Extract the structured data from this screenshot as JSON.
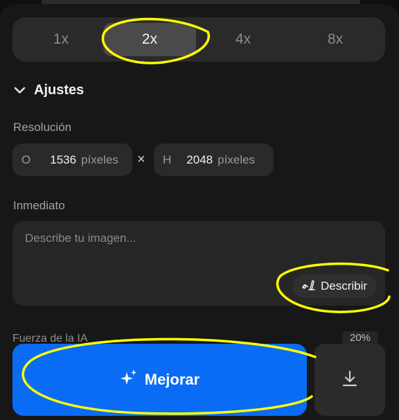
{
  "scale": {
    "options": [
      "1x",
      "2x",
      "4x",
      "8x"
    ],
    "selected": "2x"
  },
  "settings": {
    "section_label": "Ajustes",
    "resolution_label": "Resolución",
    "width_prefix": "O",
    "width_value": "1536",
    "width_unit": "píxeles",
    "times_symbol": "×",
    "height_prefix": "H",
    "height_value": "2048",
    "height_unit": "píxeles"
  },
  "prompt": {
    "label": "Inmediato",
    "placeholder": "Describe tu imagen...",
    "value": "",
    "describe_label": "Describir"
  },
  "strength": {
    "label": "Fuerza de la IA",
    "value": "20%"
  },
  "actions": {
    "enhance_label": "Mejorar",
    "download_icon": "download-icon"
  },
  "colors": {
    "accent": "#0a6cf5",
    "annotation": "#ffff00"
  }
}
